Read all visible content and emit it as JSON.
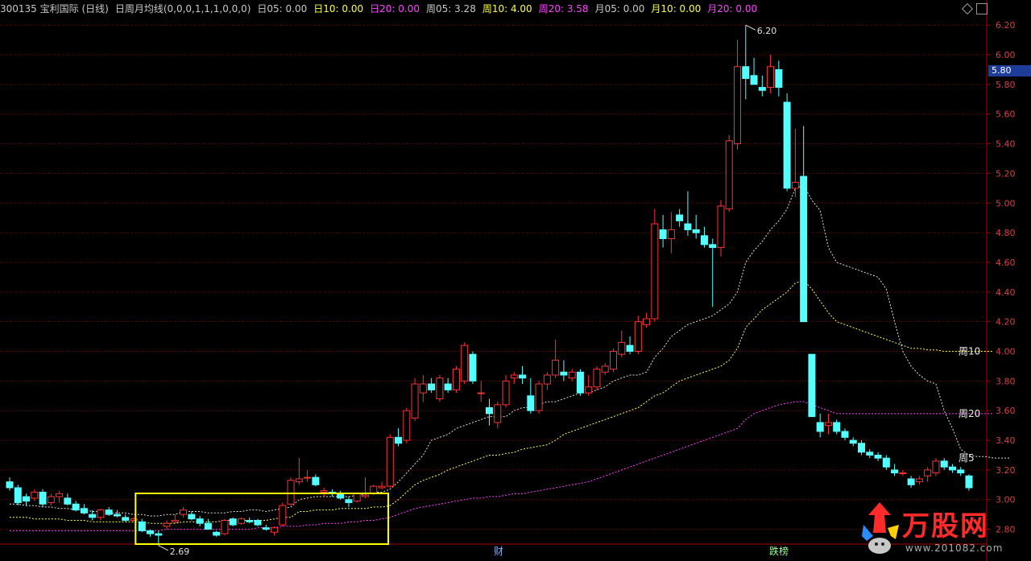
{
  "header": {
    "code_name": "300135 宝利国际 (日线)",
    "indicator": "日周月均线(0,0,0,1,1,1,0,0,0)",
    "items": [
      {
        "label": "日05: 0.00",
        "color": "#c8c8c8"
      },
      {
        "label": "日10: 0.00",
        "color": "#ffff40"
      },
      {
        "label": "日20: 0.00",
        "color": "#ff40ff"
      },
      {
        "label": "周05: 3.28",
        "color": "#c8c8c8"
      },
      {
        "label": "周10: 4.00",
        "color": "#ffff40"
      },
      {
        "label": "周20: 3.58",
        "color": "#ff40ff"
      },
      {
        "label": "月05: 0.00",
        "color": "#c8c8c8"
      },
      {
        "label": "月10: 0.00",
        "color": "#ffff40"
      },
      {
        "label": "月20: 0.00",
        "color": "#ff40ff"
      }
    ]
  },
  "current_price": "5.80",
  "bottom_markers": {
    "cai": "财",
    "longhu": "跌榜"
  },
  "logo": {
    "text": "万股网",
    "url": "www.201082.com"
  },
  "colors": {
    "up": "#ff3232",
    "down": "#54ffff",
    "week5": "#e0e0e0",
    "week10": "#ffff50",
    "week20": "#ff40ff",
    "grid": "#7a0000",
    "axis": "#b00000",
    "highlight": "#ffff00"
  },
  "chart_data": {
    "type": "candlestick",
    "ylim": [
      2.7,
      6.25
    ],
    "yticks": [
      "2.80",
      "3.00",
      "3.20",
      "3.40",
      "3.60",
      "3.80",
      "4.00",
      "4.20",
      "4.40",
      "4.60",
      "4.80",
      "5.00",
      "5.20",
      "5.40",
      "5.60",
      "5.80",
      "6.00",
      "6.20"
    ],
    "candles": [
      [
        3.12,
        3.15,
        3.06,
        3.08
      ],
      [
        3.08,
        3.1,
        2.96,
        2.98
      ],
      [
        3.02,
        3.04,
        2.96,
        2.99
      ],
      [
        3.01,
        3.07,
        2.99,
        3.05
      ],
      [
        3.05,
        3.07,
        2.95,
        2.97
      ],
      [
        2.98,
        3.04,
        2.96,
        3.02
      ],
      [
        3.02,
        3.06,
        2.98,
        3.04
      ],
      [
        3.01,
        3.04,
        2.96,
        2.97
      ],
      [
        2.97,
        2.99,
        2.92,
        2.93
      ],
      [
        2.94,
        2.97,
        2.9,
        2.91
      ],
      [
        2.9,
        2.93,
        2.86,
        2.88
      ],
      [
        2.88,
        2.94,
        2.86,
        2.93
      ],
      [
        2.93,
        2.95,
        2.89,
        2.9
      ],
      [
        2.9,
        2.93,
        2.88,
        2.89
      ],
      [
        2.88,
        2.9,
        2.85,
        2.86
      ],
      [
        2.86,
        2.88,
        2.85,
        2.87
      ],
      [
        2.85,
        2.87,
        2.78,
        2.79
      ],
      [
        2.79,
        2.8,
        2.75,
        2.77
      ],
      [
        2.77,
        2.79,
        2.69,
        2.76
      ],
      [
        2.82,
        2.86,
        2.8,
        2.84
      ],
      [
        2.85,
        2.9,
        2.84,
        2.86
      ],
      [
        2.9,
        2.95,
        2.88,
        2.93
      ],
      [
        2.9,
        2.92,
        2.86,
        2.87
      ],
      [
        2.87,
        2.89,
        2.82,
        2.84
      ],
      [
        2.84,
        2.87,
        2.8,
        2.8
      ],
      [
        2.78,
        2.79,
        2.75,
        2.76
      ],
      [
        2.77,
        2.87,
        2.76,
        2.86
      ],
      [
        2.87,
        2.88,
        2.82,
        2.83
      ],
      [
        2.84,
        2.88,
        2.83,
        2.87
      ],
      [
        2.86,
        2.88,
        2.84,
        2.85
      ],
      [
        2.86,
        2.87,
        2.82,
        2.83
      ],
      [
        2.81,
        2.83,
        2.79,
        2.8
      ],
      [
        2.78,
        2.82,
        2.76,
        2.81
      ],
      [
        2.83,
        2.98,
        2.82,
        2.96
      ],
      [
        2.97,
        3.15,
        2.96,
        3.13
      ],
      [
        3.12,
        3.28,
        3.1,
        3.14
      ],
      [
        3.15,
        3.2,
        3.12,
        3.15
      ],
      [
        3.15,
        3.17,
        3.09,
        3.1
      ],
      [
        3.05,
        3.08,
        3.02,
        3.06
      ],
      [
        3.05,
        3.07,
        3.02,
        3.04
      ],
      [
        3.04,
        3.06,
        3.0,
        3.01
      ],
      [
        3.0,
        3.02,
        2.95,
        2.98
      ],
      [
        2.99,
        3.05,
        2.98,
        3.04
      ],
      [
        3.02,
        3.15,
        3.01,
        3.03
      ],
      [
        3.04,
        3.1,
        3.03,
        3.09
      ],
      [
        3.08,
        3.12,
        3.07,
        3.09
      ],
      [
        3.09,
        3.44,
        3.08,
        3.42
      ],
      [
        3.42,
        3.48,
        3.36,
        3.38
      ],
      [
        3.4,
        3.62,
        3.38,
        3.6
      ],
      [
        3.55,
        3.82,
        3.53,
        3.78
      ],
      [
        3.72,
        3.84,
        3.66,
        3.78
      ],
      [
        3.78,
        3.82,
        3.72,
        3.74
      ],
      [
        3.68,
        3.84,
        3.66,
        3.82
      ],
      [
        3.78,
        3.82,
        3.72,
        3.74
      ],
      [
        3.74,
        3.9,
        3.72,
        3.88
      ],
      [
        3.8,
        4.06,
        3.78,
        4.04
      ],
      [
        3.98,
        4.0,
        3.78,
        3.8
      ],
      [
        3.72,
        3.8,
        3.66,
        3.72
      ],
      [
        3.62,
        3.68,
        3.5,
        3.58
      ],
      [
        3.52,
        3.66,
        3.48,
        3.64
      ],
      [
        3.64,
        3.84,
        3.62,
        3.8
      ],
      [
        3.82,
        3.86,
        3.78,
        3.84
      ],
      [
        3.84,
        3.9,
        3.78,
        3.82
      ],
      [
        3.7,
        3.82,
        3.58,
        3.6
      ],
      [
        3.6,
        3.8,
        3.58,
        3.78
      ],
      [
        3.78,
        3.86,
        3.74,
        3.84
      ],
      [
        3.84,
        4.08,
        3.82,
        3.94
      ],
      [
        3.86,
        3.94,
        3.8,
        3.84
      ],
      [
        3.82,
        3.88,
        3.8,
        3.86
      ],
      [
        3.86,
        3.88,
        3.7,
        3.72
      ],
      [
        3.72,
        3.84,
        3.7,
        3.76
      ],
      [
        3.76,
        3.9,
        3.74,
        3.88
      ],
      [
        3.86,
        3.92,
        3.84,
        3.9
      ],
      [
        3.88,
        4.02,
        3.86,
        4.0
      ],
      [
        3.98,
        4.14,
        3.96,
        4.06
      ],
      [
        4.04,
        4.1,
        3.98,
        4.0
      ],
      [
        4.0,
        4.24,
        3.98,
        4.2
      ],
      [
        4.18,
        4.26,
        4.16,
        4.22
      ],
      [
        4.22,
        4.96,
        4.2,
        4.86
      ],
      [
        4.82,
        4.92,
        4.7,
        4.76
      ],
      [
        4.76,
        4.94,
        4.66,
        4.82
      ],
      [
        4.92,
        4.96,
        4.84,
        4.88
      ],
      [
        4.86,
        5.08,
        4.78,
        4.82
      ],
      [
        4.82,
        4.92,
        4.76,
        4.8
      ],
      [
        4.78,
        4.84,
        4.7,
        4.72
      ],
      [
        4.72,
        4.76,
        4.3,
        4.7
      ],
      [
        4.7,
        5.02,
        4.64,
        4.98
      ],
      [
        4.96,
        5.46,
        4.94,
        5.42
      ],
      [
        5.4,
        6.1,
        5.36,
        5.92
      ],
      [
        5.92,
        6.2,
        5.7,
        5.84
      ],
      [
        5.86,
        5.98,
        5.8,
        5.8
      ],
      [
        5.78,
        5.86,
        5.72,
        5.76
      ],
      [
        5.78,
        6.0,
        5.74,
        5.92
      ],
      [
        5.9,
        5.96,
        5.72,
        5.78
      ],
      [
        5.68,
        5.74,
        5.08,
        5.1
      ],
      [
        5.1,
        5.5,
        5.04,
        5.14
      ],
      [
        5.18,
        5.52,
        4.2,
        4.2
      ],
      [
        3.98,
        3.98,
        3.56,
        3.56
      ],
      [
        3.52,
        3.58,
        3.42,
        3.46
      ],
      [
        3.5,
        3.58,
        3.44,
        3.52
      ],
      [
        3.52,
        3.54,
        3.44,
        3.46
      ],
      [
        3.46,
        3.48,
        3.4,
        3.42
      ],
      [
        3.4,
        3.42,
        3.36,
        3.38
      ],
      [
        3.38,
        3.4,
        3.3,
        3.32
      ],
      [
        3.32,
        3.34,
        3.28,
        3.3
      ],
      [
        3.3,
        3.32,
        3.26,
        3.28
      ],
      [
        3.28,
        3.3,
        3.2,
        3.22
      ],
      [
        3.2,
        3.24,
        3.16,
        3.18
      ],
      [
        3.18,
        3.2,
        3.16,
        3.18
      ],
      [
        3.14,
        3.16,
        3.08,
        3.1
      ],
      [
        3.12,
        3.16,
        3.1,
        3.14
      ],
      [
        3.16,
        3.22,
        3.12,
        3.2
      ],
      [
        3.18,
        3.28,
        3.16,
        3.26
      ],
      [
        3.26,
        3.28,
        3.2,
        3.22
      ],
      [
        3.22,
        3.24,
        3.18,
        3.2
      ],
      [
        3.2,
        3.22,
        3.16,
        3.18
      ],
      [
        3.16,
        3.17,
        3.06,
        3.08
      ]
    ],
    "series": [
      {
        "name": "周5",
        "values": [
          2.97,
          2.97,
          2.96,
          2.96,
          2.95,
          2.95,
          2.94,
          2.94,
          2.93,
          2.93,
          2.92,
          2.92,
          2.91,
          2.91,
          2.91,
          2.9,
          2.9,
          2.89,
          2.89,
          2.9,
          2.9,
          2.92,
          2.92,
          2.92,
          2.91,
          2.91,
          2.91,
          2.92,
          2.92,
          2.93,
          2.93,
          2.92,
          2.93,
          2.94,
          2.95,
          3.0,
          3.01,
          3.02,
          3.02,
          3.02,
          3.02,
          3.02,
          3.03,
          3.04,
          3.05,
          3.05,
          3.07,
          3.12,
          3.18,
          3.24,
          3.3,
          3.4,
          3.42,
          3.44,
          3.48,
          3.5,
          3.52,
          3.54,
          3.56,
          3.56,
          3.56,
          3.6,
          3.62,
          3.62,
          3.64,
          3.66,
          3.66,
          3.68,
          3.7,
          3.72,
          3.72,
          3.74,
          3.76,
          3.8,
          3.82,
          3.84,
          3.84,
          3.86,
          3.96,
          4.02,
          4.1,
          4.14,
          4.18,
          4.2,
          4.22,
          4.24,
          4.28,
          4.32,
          4.4,
          4.6,
          4.68,
          4.74,
          4.82,
          4.88,
          4.96,
          5.1,
          5.12,
          5.02,
          4.95,
          4.7,
          4.6,
          4.58,
          4.56,
          4.54,
          4.52,
          4.5,
          4.42,
          4.2,
          4.0,
          3.9,
          3.84,
          3.8,
          3.78,
          3.6,
          3.48,
          3.34,
          3.3,
          3.29,
          3.29,
          3.28,
          3.28,
          3.28
        ]
      },
      {
        "name": "周10",
        "values": [
          2.88,
          2.88,
          2.88,
          2.87,
          2.87,
          2.87,
          2.87,
          2.86,
          2.86,
          2.86,
          2.85,
          2.85,
          2.85,
          2.85,
          2.85,
          2.85,
          2.85,
          2.84,
          2.84,
          2.84,
          2.84,
          2.85,
          2.85,
          2.85,
          2.85,
          2.85,
          2.86,
          2.86,
          2.86,
          2.86,
          2.86,
          2.86,
          2.87,
          2.88,
          2.88,
          2.92,
          2.92,
          2.93,
          2.93,
          2.93,
          2.94,
          2.94,
          2.94,
          2.94,
          2.95,
          2.95,
          2.96,
          3.0,
          3.05,
          3.1,
          3.13,
          3.15,
          3.17,
          3.2,
          3.22,
          3.24,
          3.26,
          3.28,
          3.3,
          3.3,
          3.31,
          3.32,
          3.34,
          3.35,
          3.36,
          3.37,
          3.4,
          3.44,
          3.46,
          3.48,
          3.5,
          3.52,
          3.54,
          3.56,
          3.58,
          3.6,
          3.62,
          3.66,
          3.7,
          3.72,
          3.76,
          3.8,
          3.82,
          3.84,
          3.86,
          3.88,
          3.9,
          3.94,
          4.02,
          4.16,
          4.22,
          4.28,
          4.32,
          4.36,
          4.4,
          4.46,
          4.48,
          4.42,
          4.34,
          4.26,
          4.2,
          4.18,
          4.16,
          4.14,
          4.12,
          4.1,
          4.08,
          4.06,
          4.04,
          4.02,
          4.02,
          4.01,
          4.01,
          4.0,
          4.0,
          4.0,
          4.0,
          4.0,
          4.0,
          4.0
        ]
      },
      {
        "name": "周20",
        "values": [
          2.79,
          2.79,
          2.79,
          2.79,
          2.79,
          2.79,
          2.79,
          2.79,
          2.79,
          2.79,
          2.79,
          2.79,
          2.79,
          2.79,
          2.79,
          2.79,
          2.79,
          2.79,
          2.79,
          2.8,
          2.8,
          2.8,
          2.8,
          2.8,
          2.8,
          2.8,
          2.8,
          2.8,
          2.8,
          2.8,
          2.81,
          2.81,
          2.81,
          2.82,
          2.82,
          2.82,
          2.83,
          2.83,
          2.84,
          2.84,
          2.84,
          2.85,
          2.85,
          2.86,
          2.86,
          2.87,
          2.88,
          2.9,
          2.92,
          2.94,
          2.95,
          2.96,
          2.97,
          2.98,
          2.99,
          3.0,
          3.01,
          3.01,
          3.02,
          3.02,
          3.03,
          3.04,
          3.04,
          3.05,
          3.06,
          3.07,
          3.08,
          3.09,
          3.1,
          3.11,
          3.12,
          3.14,
          3.16,
          3.18,
          3.2,
          3.22,
          3.24,
          3.26,
          3.28,
          3.3,
          3.32,
          3.34,
          3.36,
          3.38,
          3.4,
          3.42,
          3.44,
          3.46,
          3.48,
          3.54,
          3.58,
          3.6,
          3.62,
          3.64,
          3.65,
          3.66,
          3.66,
          3.64,
          3.62,
          3.6,
          3.58,
          3.58,
          3.58,
          3.58,
          3.58,
          3.58,
          3.58,
          3.58,
          3.58,
          3.58,
          3.58,
          3.58,
          3.58,
          3.58,
          3.58,
          3.58,
          3.58,
          3.58,
          3.58,
          3.58
        ]
      }
    ],
    "annotations": {
      "high": "6.20",
      "low": "2.69"
    }
  }
}
